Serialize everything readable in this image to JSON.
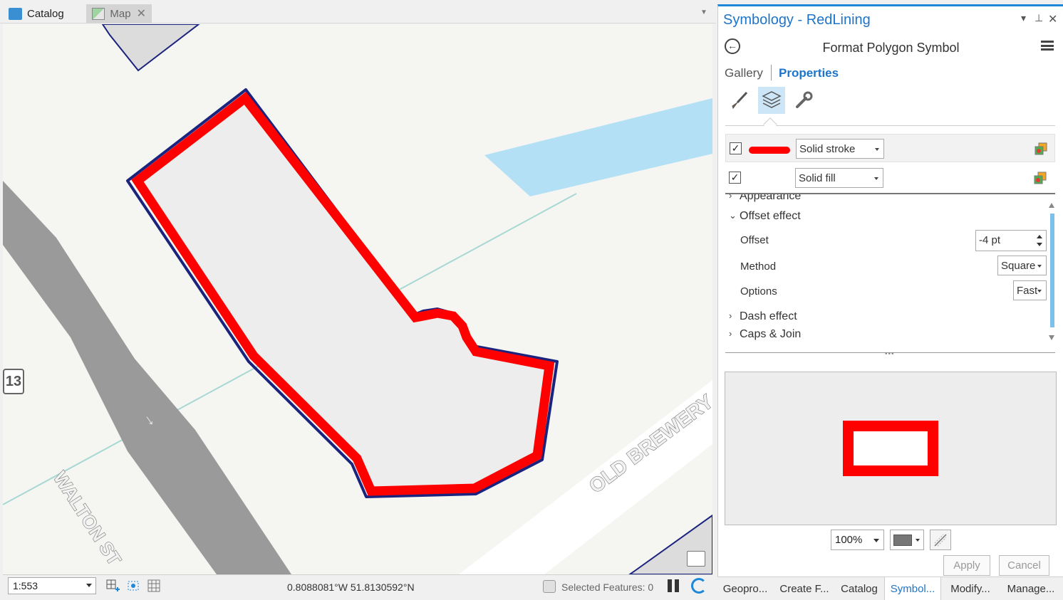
{
  "doc_tabs": {
    "catalog": "Catalog",
    "map": "Map",
    "close_glyph": "✕"
  },
  "map": {
    "route_shield": "13",
    "street_walton": "WALTON ST",
    "street_old_brewery": "OLD BREWERY",
    "colors": {
      "stroke": "#ff0000",
      "outline": "#1a237e",
      "fill": "#ededed",
      "road": "#9a9a9a",
      "water": "#b3e0f5"
    }
  },
  "status_bar": {
    "scale": "1:553",
    "coordinates": "0.8088081°W 51.8130592°N",
    "selected_features": "Selected Features: 0"
  },
  "pane": {
    "title": "Symbology - RedLining",
    "pin_glyph": "▾ ⊥",
    "close_glyph": "✕",
    "back_glyph": "←",
    "subtitle": "Format Polygon Symbol",
    "tabs": {
      "gallery": "Gallery",
      "properties": "Properties"
    },
    "layers": [
      {
        "checked": "✓",
        "type": "Solid stroke",
        "swatch": "#ff0000"
      },
      {
        "checked": "✓",
        "type": "Solid fill"
      }
    ],
    "sections": {
      "appearance": "Appearance",
      "offset_effect": "Offset effect",
      "dash_effect": "Dash effect",
      "caps_join": "Caps & Join",
      "expanded_glyph": "⌄",
      "collapsed_glyph": "›"
    },
    "properties": {
      "offset_label": "Offset",
      "offset_value": "-4 pt",
      "method_label": "Method",
      "method_value": "Square",
      "options_label": "Options",
      "options_value": "Fast"
    },
    "preview": {
      "zoom": "100%"
    },
    "buttons": {
      "apply": "Apply",
      "cancel": "Cancel"
    }
  },
  "pane_tabs": [
    "Geopro...",
    "Create F...",
    "Catalog",
    "Symbol...",
    "Modify...",
    "Manage..."
  ]
}
